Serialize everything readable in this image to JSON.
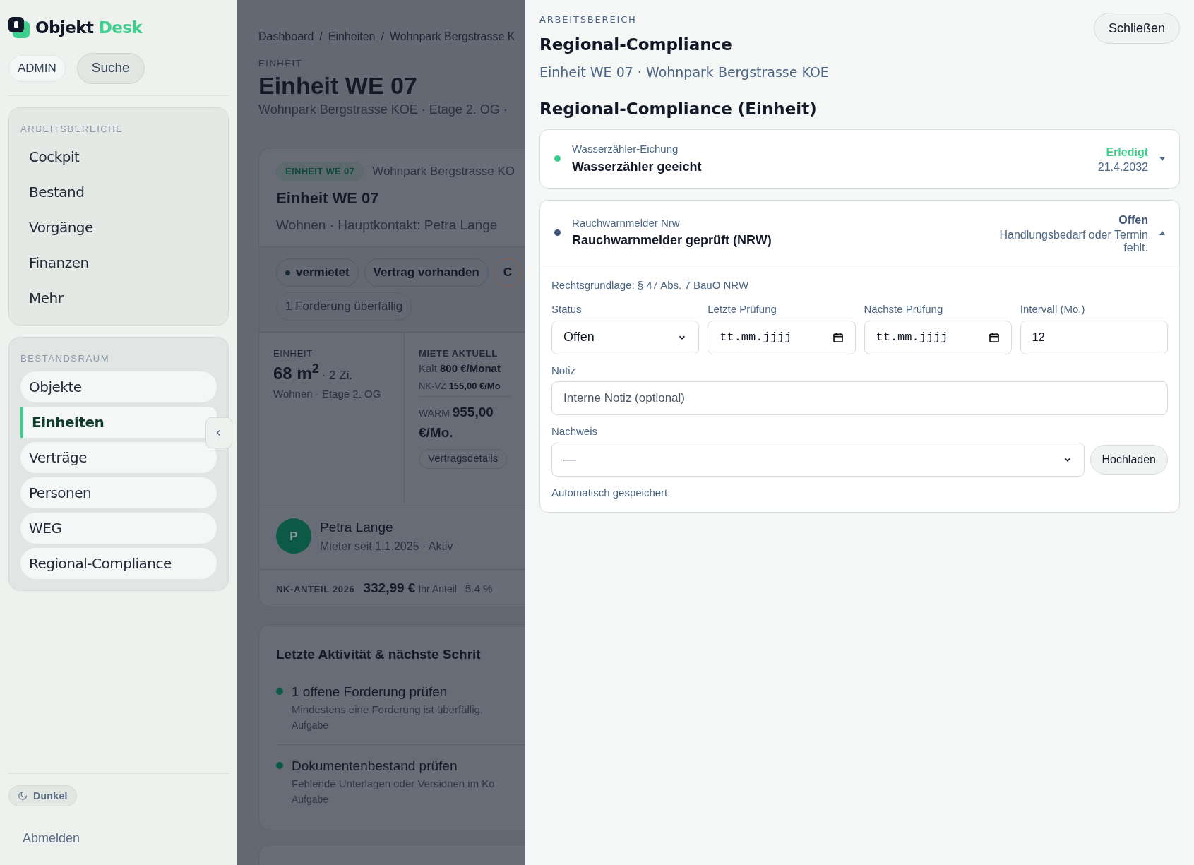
{
  "sidebar": {
    "brand": {
      "first": "Objekt",
      "second": "Desk"
    },
    "role_badge": "ADMIN",
    "search_button": "Suche",
    "sections": [
      {
        "title": "ARBEITSBEREICHE",
        "items": [
          {
            "label": "Cockpit",
            "selected": false
          },
          {
            "label": "Bestand",
            "selected": false
          },
          {
            "label": "Vorgänge",
            "selected": false
          },
          {
            "label": "Finanzen",
            "selected": false
          },
          {
            "label": "Mehr",
            "selected": false
          }
        ]
      },
      {
        "title": "BESTANDSRAUM",
        "items": [
          {
            "label": "Objekte",
            "selected": false
          },
          {
            "label": "Einheiten",
            "selected": true
          },
          {
            "label": "Verträge",
            "selected": false
          },
          {
            "label": "Personen",
            "selected": false
          },
          {
            "label": "WEG",
            "selected": false
          },
          {
            "label": "Regional-Compliance",
            "selected": false
          }
        ]
      }
    ],
    "theme_toggle": "Dunkel",
    "logout": "Abmelden"
  },
  "main": {
    "breadcrumb": [
      {
        "label": "Dashboard"
      },
      {
        "separator": "/",
        "label": "Einheiten"
      },
      {
        "separator": "/",
        "label": "Wohnpark Bergstrasse K"
      }
    ],
    "eyebrow": "EINHEIT",
    "title": "Einheit WE 07",
    "subtitle": "Wohnpark Bergstrasse KOE · Etage 2. OG ·",
    "card": {
      "badge": "EINHEIT WE 07",
      "location": "Wohnpark Bergstrasse KO",
      "title": "Einheit WE 07",
      "meta": "Wohnen · Hauptkontakt: Petra Lange",
      "chips": [
        {
          "label": "vermietet",
          "kind": "dot"
        },
        {
          "label": "Vertrag vorhanden",
          "kind": "plain"
        },
        {
          "label": "C",
          "kind": "warning"
        },
        {
          "label": "1 Forderung überfällig",
          "kind": "muted"
        }
      ],
      "unit": {
        "label": "EINHEIT",
        "area": "68 m$^{2}$",
        "rooms": "· 2 Zi.",
        "detail": "Wohnen · Etage 2. OG"
      },
      "rent": {
        "label": "MIETE AKTUELL",
        "cold_label": "Kalt",
        "cold": "800 €/Monat",
        "nk_label": "NK-VZ",
        "nk": "155,00 €/Mo",
        "warm_label": "WARM",
        "warm": "955,00 €/Mo.",
        "button": "Vertragsdetails"
      },
      "tenant": {
        "initial": "P",
        "name": "Petra Lange",
        "detail": "Mieter seit 1.1.2025 · Aktiv"
      },
      "share": {
        "label": "NK-ANTEIL 2026",
        "amount": "332,99 €",
        "caption": "Ihr Anteil",
        "percent": "5.4 %"
      }
    },
    "activity": {
      "title": "Letzte Aktivität & nächste Schrit",
      "items": [
        {
          "title": "1 offene Forderung prüfen",
          "text": "Mindestens eine Forderung ist überfällig.",
          "type": "Aufgabe"
        },
        {
          "title": "Dokumentenbestand prüfen",
          "text": "Fehlende Unterlagen oder Versionen im Ko",
          "type": "Aufgabe"
        }
      ]
    }
  },
  "drawer": {
    "eyebrow": "ARBEITSBEREICH",
    "title": "Regional-Compliance",
    "close": "Schließen",
    "subtitle": "Einheit WE 07 · Wohnpark Bergstrasse KOE",
    "heading": "Regional-Compliance (Einheit)",
    "items": [
      {
        "category": "Wasserzähler-Eichung",
        "title": "Wasserzähler geeicht",
        "status": "Erledigt",
        "detail": "21.4.2032",
        "color": "#3ecf8e",
        "expanded": false
      },
      {
        "category": "Rauchwarnmelder Nrw",
        "title": "Rauchwarnmelder geprüft (NRW)",
        "status": "Offen",
        "detail": "Handlungsbedarf oder Termin fehlt.",
        "color": "#3f5578",
        "expanded": true,
        "form": {
          "legal": "Rechtsgrundlage: § 47 Abs. 7 BauO NRW",
          "status_label": "Status",
          "status_value": "Offen",
          "last_label": "Letzte Prüfung",
          "last_placeholder": "tt.mm.jjjj",
          "next_label": "Nächste Prüfung",
          "next_placeholder": "tt.mm.jjjj",
          "interval_label": "Intervall (Mo.)",
          "interval_value": "12",
          "note_label": "Notiz",
          "note_placeholder": "Interne Notiz (optional)",
          "proof_label": "Nachweis",
          "proof_value": "—",
          "upload": "Hochladen",
          "saved": "Automatisch gespeichert."
        }
      }
    ]
  }
}
